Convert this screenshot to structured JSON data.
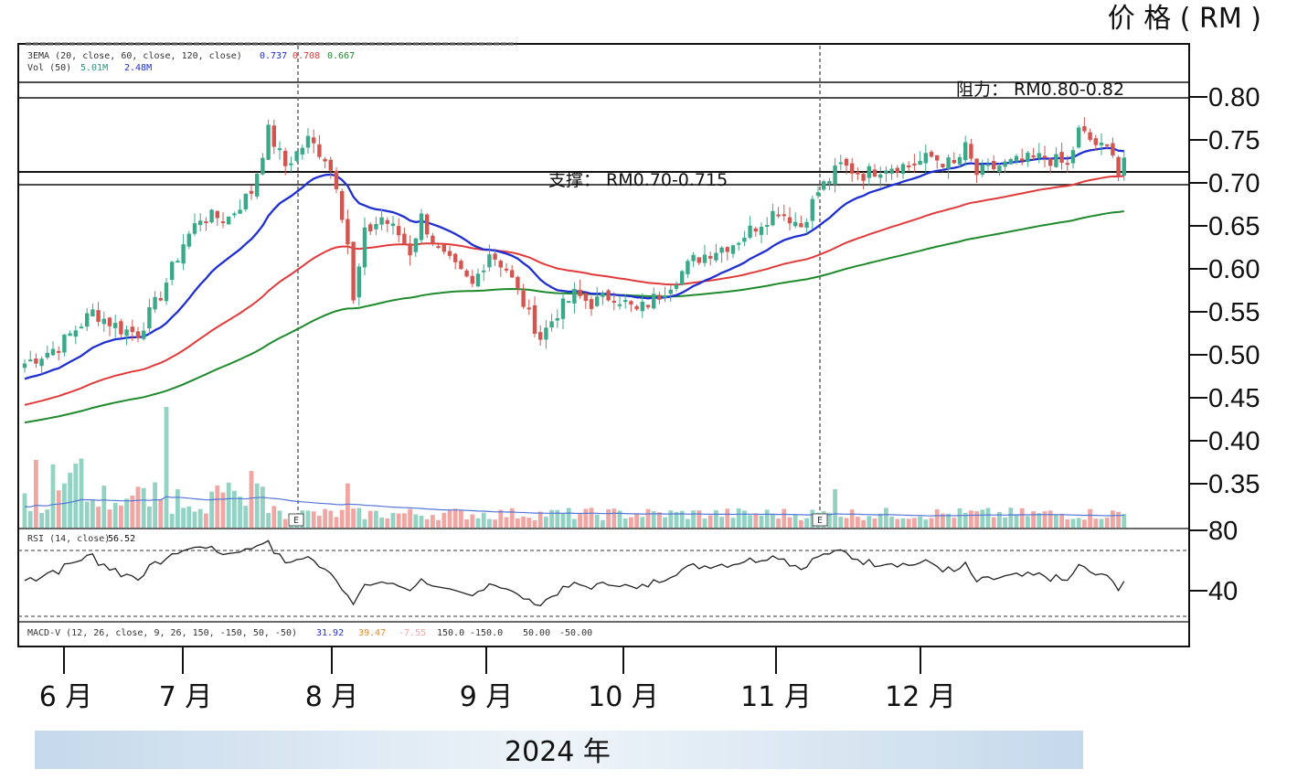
{
  "y_axis_title": "价 格 ( RM )",
  "year_label": "2024 年",
  "annotations": {
    "resistance": "阻力： RM0.80-0.82",
    "support": "支撑： RM0.70-0.715"
  },
  "indicators": {
    "ema_line": "3EMA (20, close, 60, close, 120, close)",
    "ema_values": [
      "0.737",
      "0.708",
      "0.667"
    ],
    "vol_line": "Vol (50)",
    "vol_values": [
      "5.01M",
      "2.48M"
    ],
    "rsi_line": "RSI (14, close)",
    "rsi_value": "56.52",
    "macd_line": "MACD-V (12, 26, close, 9, 26, 150, -150, 50, -50)",
    "macd_values": [
      "31.92",
      "39.47",
      "-7.55",
      "150.0",
      "-150.0",
      "50.00",
      "-50.00"
    ]
  },
  "earnings_marker": "E",
  "colors": {
    "up": "#3aa889",
    "down": "#d2554f",
    "vol_up": "#92d3c4",
    "vol_down": "#f0a7a3",
    "ema20": "#1f2fd1",
    "ema60": "#e03a3a",
    "ema120": "#1f8a2c",
    "vol_ma": "#5577d8",
    "year_band": "#cfe0ee"
  },
  "chart_data": {
    "type": "candlestick",
    "y_axis_ticks": [
      "0.80",
      "0.75",
      "0.70",
      "0.65",
      "0.60",
      "0.55",
      "0.50",
      "0.45",
      "0.40",
      "0.35"
    ],
    "rsi_ticks": [
      "80",
      "40"
    ],
    "ylim": [
      0.33,
      0.84
    ],
    "month_labels": [
      "6 月",
      "7 月",
      "8 月",
      "9 月",
      "10 月",
      "11 月",
      "12 月"
    ],
    "resistance_zone": [
      0.8,
      0.82
    ],
    "support_zone": [
      0.7,
      0.715
    ],
    "ema_last": {
      "ema20": 0.737,
      "ema60": 0.708,
      "ema120": 0.667
    },
    "close_key_points": [
      {
        "x": 0,
        "y": 0.49
      },
      {
        "x": 6,
        "y": 0.51
      },
      {
        "x": 12,
        "y": 0.55
      },
      {
        "x": 17,
        "y": 0.53
      },
      {
        "x": 20,
        "y": 0.525
      },
      {
        "x": 24,
        "y": 0.57
      },
      {
        "x": 28,
        "y": 0.63
      },
      {
        "x": 31,
        "y": 0.66
      },
      {
        "x": 36,
        "y": 0.66
      },
      {
        "x": 40,
        "y": 0.69
      },
      {
        "x": 43,
        "y": 0.76
      },
      {
        "x": 46,
        "y": 0.72
      },
      {
        "x": 50,
        "y": 0.75
      },
      {
        "x": 53,
        "y": 0.73
      },
      {
        "x": 55,
        "y": 0.7
      },
      {
        "x": 57,
        "y": 0.63
      },
      {
        "x": 58,
        "y": 0.56
      },
      {
        "x": 60,
        "y": 0.64
      },
      {
        "x": 63,
        "y": 0.66
      },
      {
        "x": 66,
        "y": 0.64
      },
      {
        "x": 68,
        "y": 0.62
      },
      {
        "x": 70,
        "y": 0.66
      },
      {
        "x": 73,
        "y": 0.62
      },
      {
        "x": 76,
        "y": 0.6
      },
      {
        "x": 79,
        "y": 0.58
      },
      {
        "x": 82,
        "y": 0.62
      },
      {
        "x": 85,
        "y": 0.6
      },
      {
        "x": 88,
        "y": 0.56
      },
      {
        "x": 91,
        "y": 0.52
      },
      {
        "x": 94,
        "y": 0.55
      },
      {
        "x": 97,
        "y": 0.57
      },
      {
        "x": 100,
        "y": 0.56
      },
      {
        "x": 104,
        "y": 0.57
      },
      {
        "x": 108,
        "y": 0.55
      },
      {
        "x": 112,
        "y": 0.57
      },
      {
        "x": 115,
        "y": 0.59
      },
      {
        "x": 118,
        "y": 0.61
      },
      {
        "x": 121,
        "y": 0.62
      },
      {
        "x": 125,
        "y": 0.63
      },
      {
        "x": 129,
        "y": 0.65
      },
      {
        "x": 133,
        "y": 0.67
      },
      {
        "x": 137,
        "y": 0.65
      },
      {
        "x": 140,
        "y": 0.69
      },
      {
        "x": 144,
        "y": 0.72
      },
      {
        "x": 148,
        "y": 0.71
      },
      {
        "x": 152,
        "y": 0.72
      },
      {
        "x": 156,
        "y": 0.72
      },
      {
        "x": 160,
        "y": 0.73
      },
      {
        "x": 164,
        "y": 0.72
      },
      {
        "x": 166,
        "y": 0.74
      },
      {
        "x": 168,
        "y": 0.71
      },
      {
        "x": 172,
        "y": 0.72
      },
      {
        "x": 176,
        "y": 0.725
      },
      {
        "x": 180,
        "y": 0.73
      },
      {
        "x": 184,
        "y": 0.72
      },
      {
        "x": 186,
        "y": 0.76
      },
      {
        "x": 190,
        "y": 0.74
      },
      {
        "x": 192,
        "y": 0.74
      },
      {
        "x": 193,
        "y": 0.71
      },
      {
        "x": 194,
        "y": 0.73
      }
    ]
  }
}
